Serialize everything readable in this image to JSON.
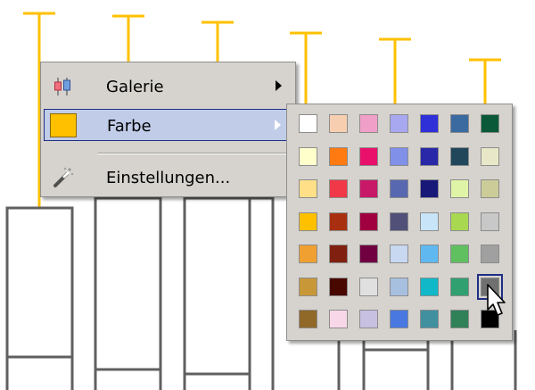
{
  "menu": {
    "items": [
      {
        "label": "Galerie",
        "icon": "gallery-icon",
        "has_submenu": true
      },
      {
        "label": "Farbe",
        "icon": "color-swatch-icon",
        "has_submenu": true,
        "active": true
      },
      {
        "label": "Einstellungen...",
        "icon": "magic-wand-icon",
        "has_submenu": false
      }
    ],
    "current_color": "#ffc000"
  },
  "palette": {
    "columns": 7,
    "selected_index": 41,
    "colors": [
      "#ffffff",
      "#f7cfb0",
      "#f0a0c8",
      "#a8a8f0",
      "#3030d8",
      "#3a6aa0",
      "#0a5a3a",
      "#ffffcc",
      "#ff7a10",
      "#e8106a",
      "#8090e8",
      "#2828a8",
      "#20485a",
      "#e8e8c8",
      "#ffe088",
      "#f03848",
      "#c81868",
      "#5868b0",
      "#181878",
      "#e0f4a8",
      "#cccc98",
      "#ffc000",
      "#a83010",
      "#a00040",
      "#505078",
      "#c8e4f8",
      "#a8d850",
      "#c8c8c8",
      "#f0a030",
      "#802010",
      "#700040",
      "#c8d8f0",
      "#60b8f0",
      "#60c060",
      "#a0a0a0",
      "#c89838",
      "#480800",
      "#e0e0e0",
      "#a8c0e0",
      "#10b8c8",
      "#30a070",
      "#707070",
      "#906828",
      "#f8d8e8",
      "#c8c0e0",
      "#4878e0",
      "#4090a0",
      "#308058",
      "#000000"
    ]
  },
  "chart_colors": {
    "whisker": "#ffc000",
    "box": "#606060"
  }
}
